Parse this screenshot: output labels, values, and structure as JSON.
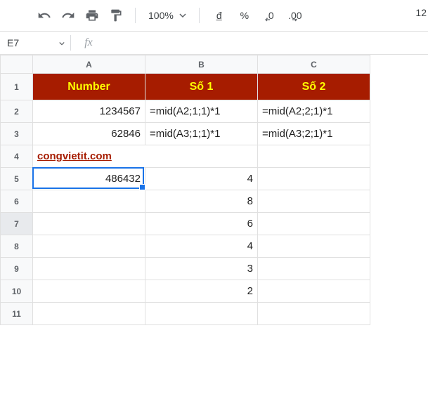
{
  "toolbar": {
    "zoom": "100%",
    "currency": "đ̲",
    "percent": "%",
    "dec_less": ".0",
    "dec_more": ".00",
    "trunc_num": "12"
  },
  "namebox": "E7",
  "fx_label": "fx",
  "columns": [
    "A",
    "B",
    "C"
  ],
  "rows": [
    "1",
    "2",
    "3",
    "4",
    "5",
    "6",
    "7",
    "8",
    "9",
    "10",
    "11"
  ],
  "cells": {
    "r1": {
      "A": "Number",
      "B": "Số 1",
      "C": "Số 2"
    },
    "r2": {
      "A": "1234567",
      "B": "=mid(A2;1;1)*1",
      "C": "=mid(A2;2;1)*1"
    },
    "r3": {
      "A": "62846",
      "B": "=mid(A3;1;1)*1",
      "C": "=mid(A3;2;1)*1"
    },
    "r4": {
      "link": "congvietit.com"
    },
    "r5": {
      "A": "486432",
      "B": "4"
    },
    "r6": {
      "B": "8"
    },
    "r7": {
      "B": "6"
    },
    "r8": {
      "B": "4"
    },
    "r9": {
      "B": "3"
    },
    "r10": {
      "B": "2"
    }
  }
}
